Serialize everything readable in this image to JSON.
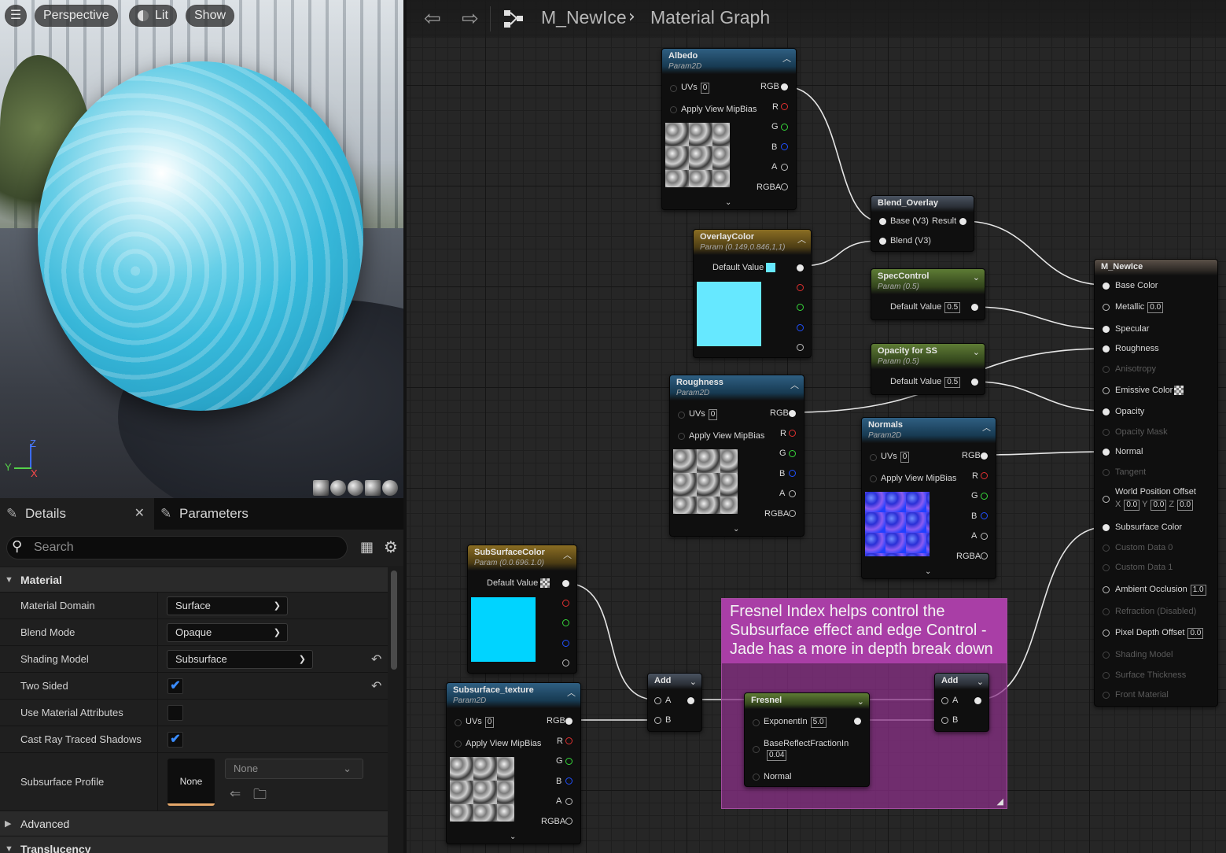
{
  "viewport": {
    "menu_label": "☰",
    "perspective": "Perspective",
    "lit": "Lit",
    "show": "Show",
    "axis": {
      "z": "Z",
      "y": "Y",
      "x": "X"
    }
  },
  "details": {
    "tab_details": "Details",
    "tab_parameters": "Parameters",
    "close": "✕",
    "search_placeholder": "Search",
    "category_material": "Material",
    "category_advanced": "Advanced",
    "category_translucency": "Translucency",
    "rows": {
      "material_domain": {
        "label": "Material Domain",
        "value": "Surface"
      },
      "blend_mode": {
        "label": "Blend Mode",
        "value": "Opaque"
      },
      "shading_model": {
        "label": "Shading Model",
        "value": "Subsurface"
      },
      "two_sided": {
        "label": "Two Sided",
        "checked": true
      },
      "use_material_attributes": {
        "label": "Use Material Attributes",
        "checked": false
      },
      "cast_ray_traced_shadows": {
        "label": "Cast Ray Traced Shadows",
        "checked": true
      },
      "subsurface_profile": {
        "label": "Subsurface Profile",
        "thumb": "None",
        "value": "None"
      }
    },
    "checkmark": "✔"
  },
  "graph": {
    "breadcrumb": {
      "asset": "M_NewIce",
      "page": "Material Graph"
    },
    "nodes": {
      "albedo": {
        "title": "Albedo",
        "sub": "Param2D",
        "uvs": "UVs",
        "uvs_val": "0",
        "mip": "Apply View MipBias",
        "out": [
          "RGB",
          "R",
          "G",
          "B",
          "A",
          "RGBA"
        ]
      },
      "overlay": {
        "title": "OverlayColor",
        "sub": "Param (0.149,0.846,1,1)",
        "default": "Default Value",
        "swatch": "#66e8ff"
      },
      "blend": {
        "title": "Blend_Overlay",
        "base": "Base (V3)",
        "blend": "Blend (V3)",
        "result": "Result"
      },
      "spec": {
        "title": "SpecControl",
        "sub": "Param (0.5)",
        "default": "Default Value",
        "val": "0.5"
      },
      "opacity": {
        "title": "Opacity for SS",
        "sub": "Param (0.5)",
        "default": "Default Value",
        "val": "0.5"
      },
      "roughness": {
        "title": "Roughness",
        "sub": "Param2D",
        "uvs": "UVs",
        "uvs_val": "0",
        "mip": "Apply View MipBias",
        "out": [
          "RGB",
          "R",
          "G",
          "B",
          "A",
          "RGBA"
        ]
      },
      "normals": {
        "title": "Normals",
        "sub": "Param2D",
        "uvs": "UVs",
        "uvs_val": "0",
        "mip": "Apply View MipBias",
        "out": [
          "RGB",
          "R",
          "G",
          "B",
          "A",
          "RGBA"
        ]
      },
      "sscolor": {
        "title": "SubSurfaceColor",
        "sub": "Param (0.0.696.1.0)",
        "default": "Default Value",
        "swatch": "#00d4ff"
      },
      "sstex": {
        "title": "Subsurface_texture",
        "sub": "Param2D",
        "uvs": "UVs",
        "uvs_val": "0",
        "mip": "Apply View MipBias",
        "out": [
          "RGB",
          "R",
          "G",
          "B",
          "A",
          "RGBA"
        ]
      },
      "add1": {
        "title": "Add",
        "a": "A",
        "b": "B"
      },
      "add2": {
        "title": "Add",
        "a": "A",
        "b": "B"
      },
      "fresnel": {
        "title": "Fresnel",
        "exp": "ExponentIn",
        "exp_val": "5.0",
        "brf": "BaseReflectFractionIn",
        "brf_val": "0.04",
        "normal": "Normal"
      },
      "result": {
        "title": "M_NewIce",
        "pins": {
          "base_color": "Base Color",
          "metallic": "Metallic",
          "metallic_val": "0.0",
          "specular": "Specular",
          "roughness": "Roughness",
          "anisotropy": "Anisotropy",
          "emissive": "Emissive Color",
          "opacity": "Opacity",
          "opacity_mask": "Opacity Mask",
          "normal": "Normal",
          "tangent": "Tangent",
          "wpo": "World Position Offset",
          "wpo_x": "X",
          "wpo_x_val": "0.0",
          "wpo_y": "Y",
          "wpo_y_val": "0.0",
          "wpo_z": "Z",
          "wpo_z_val": "0.0",
          "subsurface": "Subsurface Color",
          "custom0": "Custom Data 0",
          "custom1": "Custom Data 1",
          "ao": "Ambient Occlusion",
          "ao_val": "1.0",
          "refraction": "Refraction (Disabled)",
          "pdo": "Pixel Depth Offset",
          "pdo_val": "0.0",
          "shading_model": "Shading Model",
          "surface_thickness": "Surface Thickness",
          "front_material": "Front Material"
        }
      }
    },
    "comment": "Fresnel Index helps control the Subsurface effect and edge Control - Jade has a more in depth break down"
  }
}
